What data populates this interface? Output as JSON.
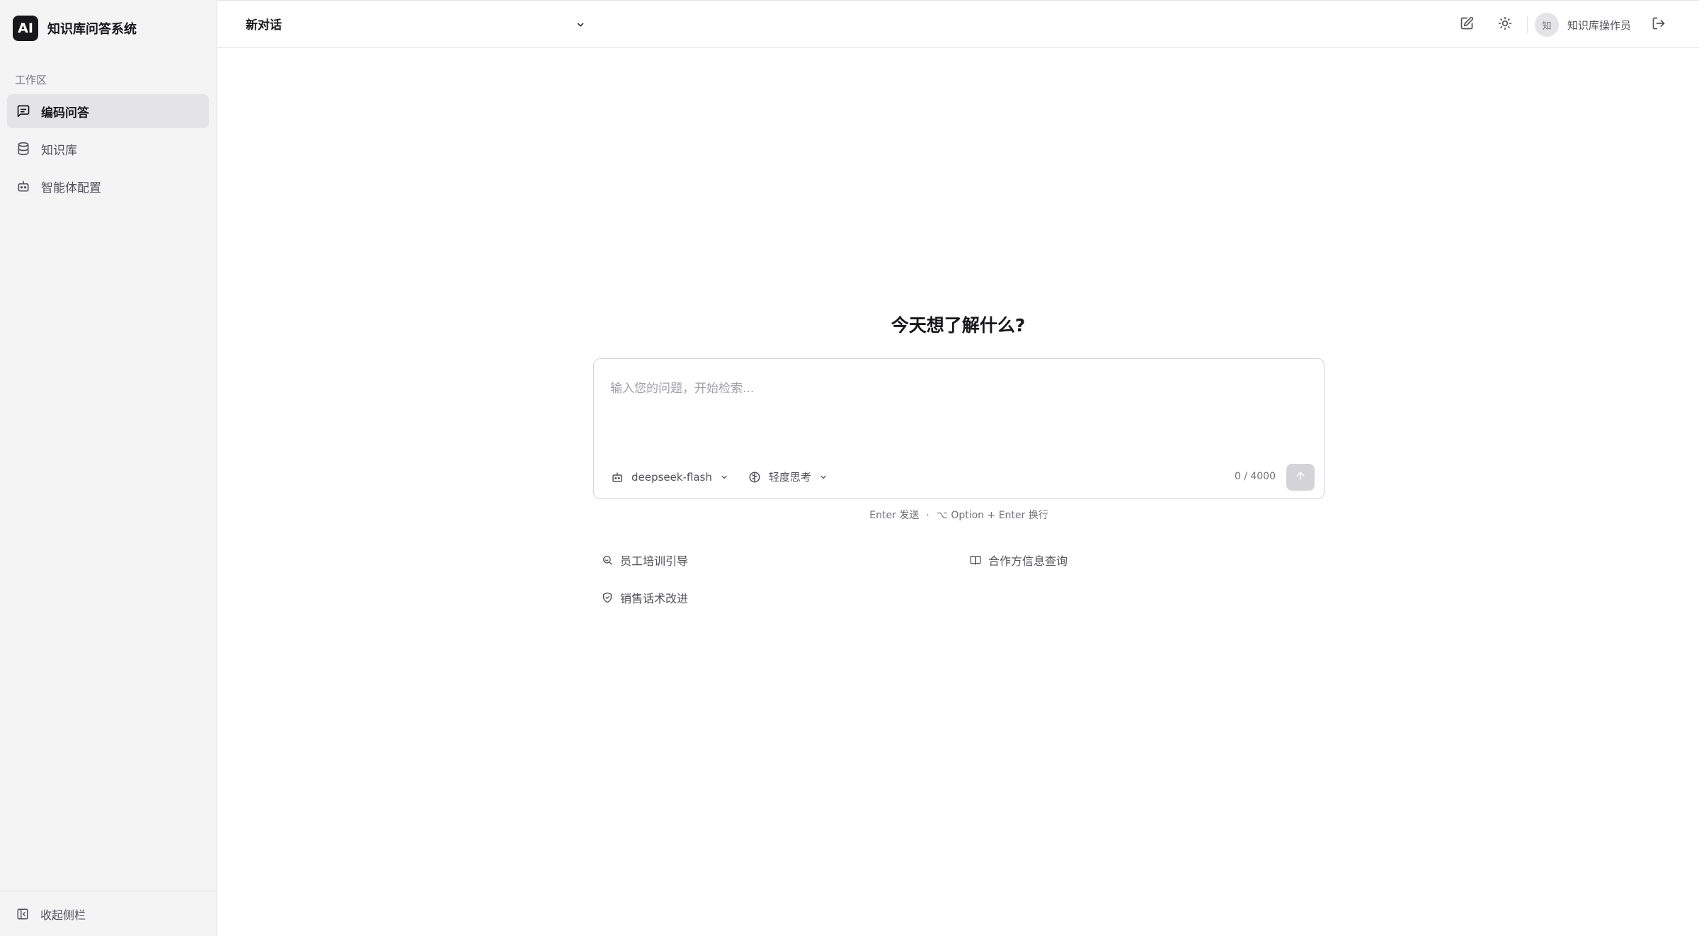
{
  "brand": {
    "logo_text": "AI",
    "name": "知识库问答系统"
  },
  "sidebar": {
    "section_label": "工作区",
    "items": [
      {
        "label": "编码问答",
        "icon": "chat-icon",
        "active": true
      },
      {
        "label": "知识库",
        "icon": "database-icon",
        "active": false
      },
      {
        "label": "智能体配置",
        "icon": "bot-icon",
        "active": false
      }
    ],
    "collapse_label": "收起侧栏"
  },
  "topbar": {
    "conversation_title": "新对话",
    "user_avatar": "知",
    "user_name": "知识库操作员"
  },
  "main": {
    "heading": "今天想了解什么?",
    "input_placeholder": "输入您的问题，开始检索...",
    "input_value": "",
    "model_label": "deepseek-flash",
    "thinking_label": "轻度思考",
    "counter": "0 / 4000",
    "hint_send": "Enter 发送",
    "hint_separator": "·",
    "hint_newline": "⌥ Option + Enter 换行",
    "suggestions": [
      {
        "label": "员工培训引导",
        "icon": "search-icon"
      },
      {
        "label": "合作方信息查询",
        "icon": "book-icon"
      },
      {
        "label": "销售话术改进",
        "icon": "shield-check-icon"
      }
    ]
  },
  "colors": {
    "accent": "#18181b",
    "sidebar_bg": "#f4f4f5",
    "active_bg": "#e4e4e7",
    "send_disabled": "#d4d4d8"
  }
}
